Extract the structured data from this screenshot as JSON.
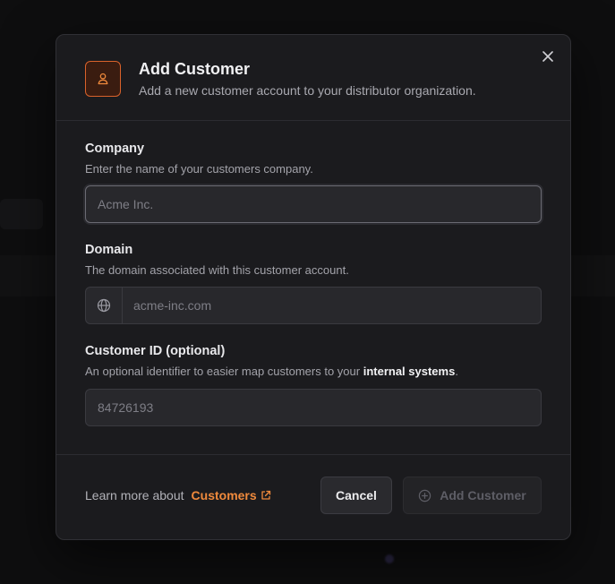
{
  "modal": {
    "title": "Add Customer",
    "subtitle": "Add a new customer account to your distributor organization.",
    "header_icon": "user-icon",
    "close_icon": "close-icon"
  },
  "fields": {
    "company": {
      "label": "Company",
      "description": "Enter the name of your customers company.",
      "placeholder": "Acme Inc."
    },
    "domain": {
      "label": "Domain",
      "description": "The domain associated with this customer account.",
      "placeholder": "acme-inc.com",
      "addon_icon": "globe-icon"
    },
    "customer_id": {
      "label": "Customer ID (optional)",
      "description_prefix": "An optional identifier to easier map customers to your ",
      "description_emphasis": "internal systems",
      "description_suffix": ".",
      "placeholder": "84726193"
    }
  },
  "footer": {
    "learn_more_text": "Learn more about",
    "learn_more_link": "Customers",
    "link_icon": "external-link-icon",
    "cancel_label": "Cancel",
    "submit_label": "Add Customer",
    "submit_icon": "plus-circle-icon"
  },
  "colors": {
    "accent": "#f08a3c",
    "icon_border": "#d9622b",
    "modal_bg": "#1b1b1e",
    "page_bg": "#111113"
  }
}
